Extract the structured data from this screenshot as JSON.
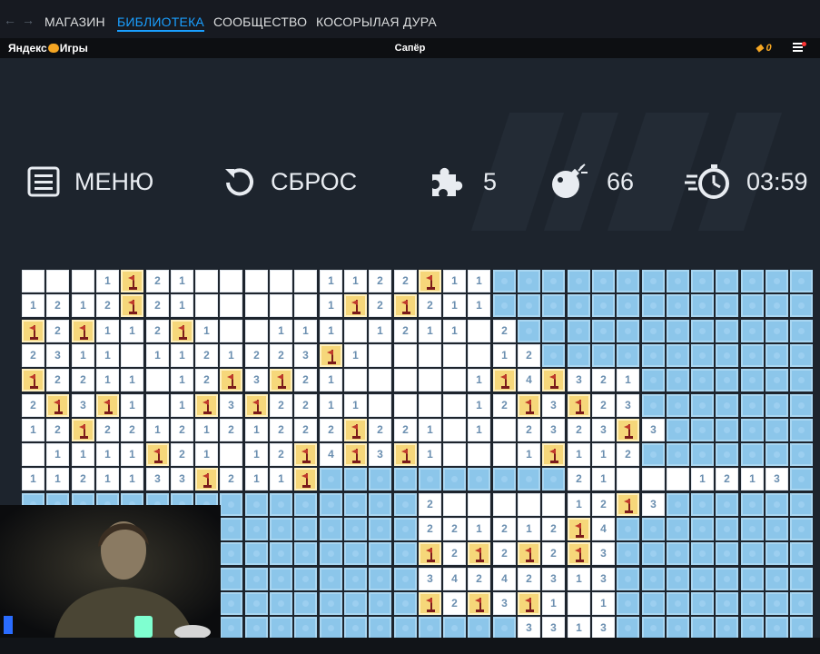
{
  "steam": {
    "tabs": [
      "МАГАЗИН",
      "БИБЛИОТЕКА",
      "СООБЩЕСТВО",
      "КОСОРЫЛАЯ ДУРА"
    ],
    "active_tab": "БИБЛИОТЕКА",
    "nav_icons": [
      "back-arrow-icon",
      "forward-arrow-icon"
    ]
  },
  "yandex": {
    "logo_left": "Яндекс",
    "logo_right": "Игры",
    "title": "Сапёр",
    "coins": "0",
    "menu_icon": "hamburger-menu-icon"
  },
  "hud": {
    "menu_label": "МЕНЮ",
    "reset_label": "СБРОС",
    "hints_count": "5",
    "mines_count": "66",
    "timer": "03:59",
    "icons": [
      "menu-list-icon",
      "reset-icon",
      "puzzle-icon",
      "bomb-icon",
      "stopwatch-icon"
    ]
  },
  "board": {
    "columns": 32,
    "rows": 16,
    "legend": {
      "#": "unopened",
      ".": "opened-empty",
      "F": "flag",
      "1-8": "number"
    },
    "colors": {
      "unopened": "#8cc6ea",
      "opened": "#ffffff",
      "flag": "#f6d77a",
      "number": "#6b8fb0"
    },
    "cells": [
      "...1F21.....1122F11#############",
      "1212F21.....1F2F211#############",
      "F2F112F1..111.1211.2############",
      "2311.1121223F1.....12###########",
      "F2211.12F3F21.....1F4F321#######",
      "2F3F1.1F3F2211....12F3F23#######",
      "12F2212121222F221.1.2323F3######",
      ".1111F21.12F4F3F1...1F112#######",
      "1121133F211F##########21...1213#",
      "################2.....12F3######",
      "################221212F4########",
      "################F2F2F2F3########",
      "################34242313########",
      "################F2F3F1.1########",
      "####################3313########",
      "################################"
    ]
  },
  "overlay": {
    "webcam": "streamer-webcam"
  }
}
